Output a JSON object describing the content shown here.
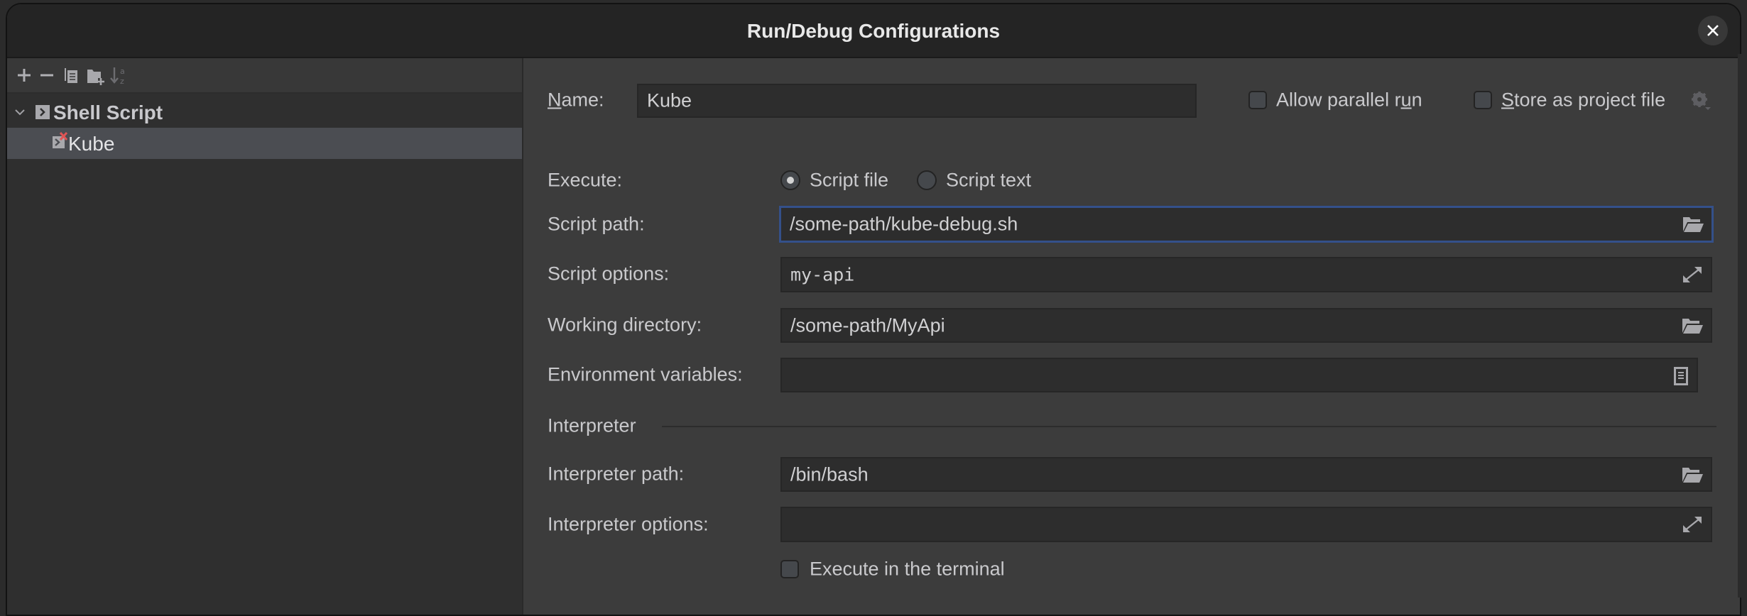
{
  "window": {
    "title": "Run/Debug Configurations"
  },
  "toolbar": {
    "icons": [
      "plus-icon",
      "minus-icon",
      "copy-icon",
      "new-folder-icon",
      "sort-alpha-icon"
    ]
  },
  "tree": {
    "group": {
      "label": "Shell Script",
      "expanded": true
    },
    "items": [
      {
        "label": "Kube",
        "selected": true,
        "error": true
      }
    ]
  },
  "form": {
    "name_label_n": "N",
    "name_label_rest": "ame:",
    "name_value": "Kube",
    "allow_parallel": {
      "pre": "Allow parallel r",
      "u": "u",
      "post": "n",
      "checked": false
    },
    "store_project": {
      "u": "S",
      "post": "tore as project file",
      "checked": false
    },
    "execute_label": "Execute:",
    "execute_options": [
      {
        "label": "Script file",
        "selected": true
      },
      {
        "label": "Script text",
        "selected": false
      }
    ],
    "script_path": {
      "label": "Script path:",
      "value": "/some-path/kube-debug.sh"
    },
    "script_options": {
      "label": "Script options:",
      "value": "my-api"
    },
    "working_directory": {
      "label": "Working directory:",
      "value": "/some-path/MyApi"
    },
    "environment_variables": {
      "label": "Environment variables:",
      "value": ""
    },
    "interpreter_section": "Interpreter",
    "interpreter_path": {
      "label": "Interpreter path:",
      "value": "/bin/bash"
    },
    "interpreter_options": {
      "label": "Interpreter options:",
      "value": ""
    },
    "execute_in_terminal": {
      "label": "Execute in the terminal",
      "checked": false
    }
  },
  "colors": {
    "focus_border": "#34508a",
    "selection": "#4b4d52",
    "error_mark": "#e05555"
  }
}
